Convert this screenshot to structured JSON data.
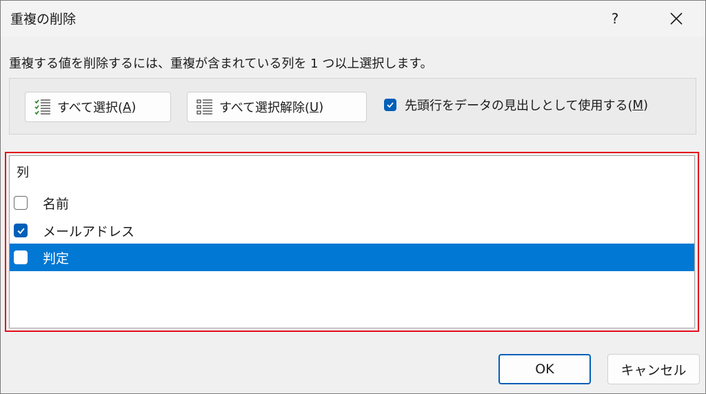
{
  "dialog": {
    "title": "重複の削除",
    "help_label": "?",
    "close_icon": "close-icon",
    "instruction": "重複する値を削除するには、重複が含まれている列を 1 つ以上選択します。"
  },
  "toolbar": {
    "select_all": {
      "label": "すべて選択(",
      "accel": "A",
      "suffix": ")",
      "icon": "select-all-icon"
    },
    "deselect_all": {
      "label": "すべて選択解除(",
      "accel": "U",
      "suffix": ")",
      "icon": "deselect-all-icon"
    },
    "header_checkbox": {
      "label": "先頭行をデータの見出しとして使用する(",
      "accel": "M",
      "suffix": ")",
      "checked": true
    }
  },
  "columns": {
    "header": "列",
    "items": [
      {
        "label": "名前",
        "checked": false,
        "selected": false
      },
      {
        "label": "メールアドレス",
        "checked": true,
        "selected": false
      },
      {
        "label": "判定",
        "checked": false,
        "selected": true
      }
    ]
  },
  "footer": {
    "ok_label": "OK",
    "cancel_label": "キャンセル"
  },
  "colors": {
    "accent": "#005fb8",
    "selection": "#0078d4",
    "highlight_border": "#e3101b",
    "select_all_icon": "#2e8b2e"
  }
}
